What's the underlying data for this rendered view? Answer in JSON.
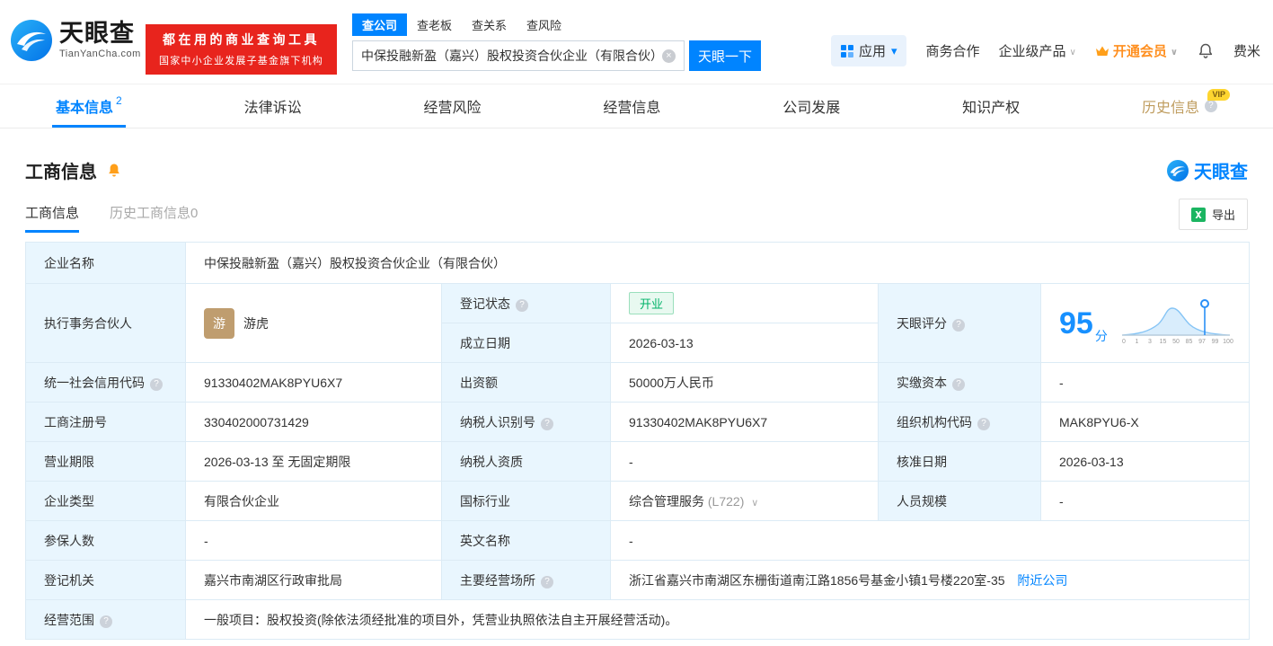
{
  "header": {
    "logo": {
      "brand": "天眼查",
      "domain": "TianYanCha.com"
    },
    "promo": {
      "line1": "都在用的商业查询工具",
      "line2": "国家中小企业发展子基金旗下机构"
    },
    "search_tabs": [
      {
        "label": "查公司"
      },
      {
        "label": "查老板"
      },
      {
        "label": "查关系"
      },
      {
        "label": "查风险"
      }
    ],
    "search": {
      "value": "中保投融新盈（嘉兴）股权投资合伙企业（有限合伙）",
      "button": "天眼一下"
    },
    "right": {
      "apps": "应用",
      "cooperation": "商务合作",
      "enterprise": "企业级产品",
      "membership": "开通会员",
      "account": "费米"
    }
  },
  "nav_tabs": [
    {
      "label": "基本信息",
      "badge": "2"
    },
    {
      "label": "法律诉讼"
    },
    {
      "label": "经营风险"
    },
    {
      "label": "经营信息"
    },
    {
      "label": "公司发展"
    },
    {
      "label": "知识产权"
    },
    {
      "label": "历史信息",
      "tag": "VIP"
    }
  ],
  "section": {
    "title": "工商信息",
    "brand": "天眼查",
    "subtabs": [
      {
        "label": "工商信息"
      },
      {
        "label": "历史工商信息0"
      }
    ],
    "export": "导出"
  },
  "info": {
    "company_name": {
      "label": "企业名称",
      "value": "中保投融新盈（嘉兴）股权投资合伙企业（有限合伙）"
    },
    "partner": {
      "label": "执行事务合伙人",
      "avatar": "游",
      "value": "游虎"
    },
    "reg_status": {
      "label": "登记状态",
      "value": "开业"
    },
    "establish_date": {
      "label": "成立日期",
      "value": "2026-03-13"
    },
    "score": {
      "label": "天眼评分",
      "value": "95",
      "unit": "分",
      "axis": [
        "0",
        "1",
        "3",
        "15",
        "50",
        "85",
        "97",
        "99",
        "100"
      ]
    },
    "credit_code": {
      "label": "统一社会信用代码",
      "value": "91330402MAK8PYU6X7"
    },
    "capital": {
      "label": "出资额",
      "value": "50000万人民币"
    },
    "paid_capital": {
      "label": "实缴资本",
      "value": "-"
    },
    "reg_number": {
      "label": "工商注册号",
      "value": "330402000731429"
    },
    "taxpayer_id": {
      "label": "纳税人识别号",
      "value": "91330402MAK8PYU6X7"
    },
    "org_code": {
      "label": "组织机构代码",
      "value": "MAK8PYU6-X"
    },
    "business_term": {
      "label": "营业期限",
      "value": "2026-03-13 至 无固定期限"
    },
    "taxpayer_quality": {
      "label": "纳税人资质",
      "value": "-"
    },
    "approval_date": {
      "label": "核准日期",
      "value": "2026-03-13"
    },
    "company_type": {
      "label": "企业类型",
      "value": "有限合伙企业"
    },
    "industry": {
      "label": "国标行业",
      "value": "综合管理服务",
      "code": "(L722)"
    },
    "staff_size": {
      "label": "人员规模",
      "value": "-"
    },
    "insured_count": {
      "label": "参保人数",
      "value": "-"
    },
    "english_name": {
      "label": "英文名称",
      "value": "-"
    },
    "reg_authority": {
      "label": "登记机关",
      "value": "嘉兴市南湖区行政审批局"
    },
    "business_site": {
      "label": "主要经营场所",
      "value": "浙江省嘉兴市南湖区东栅街道南江路1856号基金小镇1号楼220室-35",
      "link": "附近公司"
    },
    "business_scope": {
      "label": "经营范围",
      "value": "一般项目：股权投资(除依法须经批准的项目外，凭营业执照依法自主开展经营活动)。"
    }
  }
}
